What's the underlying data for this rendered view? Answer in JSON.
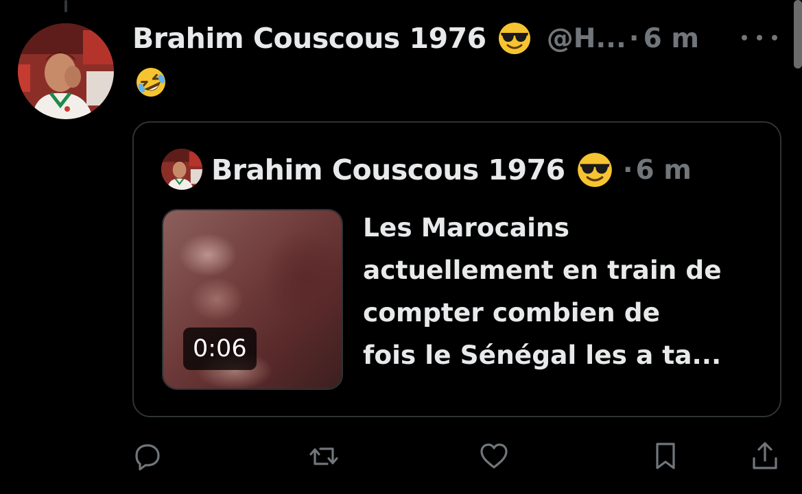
{
  "tweet": {
    "display_name": "Brahim Couscous 1976",
    "name_emoji": "sunglasses-face-emoji",
    "handle": "@H...",
    "separator": "·",
    "time": "6 m",
    "body_emoji": "rolling-on-floor-laughing-emoji"
  },
  "quoted_tweet": {
    "display_name": "Brahim Couscous 1976",
    "name_emoji": "sunglasses-face-emoji",
    "separator": "·",
    "time": "6 m",
    "video_duration": "0:06",
    "text": "Les Marocains\nactuellement en train de\ncompter combien de\nfois le Sénégal les a ta..."
  },
  "actions": [
    "reply-icon",
    "retweet-icon",
    "like-icon",
    "bookmark-icon",
    "share-icon"
  ],
  "colors": {
    "background": "#000000",
    "primary_text": "#e7e9ea",
    "secondary_text": "#71767b",
    "border": "#2f3336"
  }
}
